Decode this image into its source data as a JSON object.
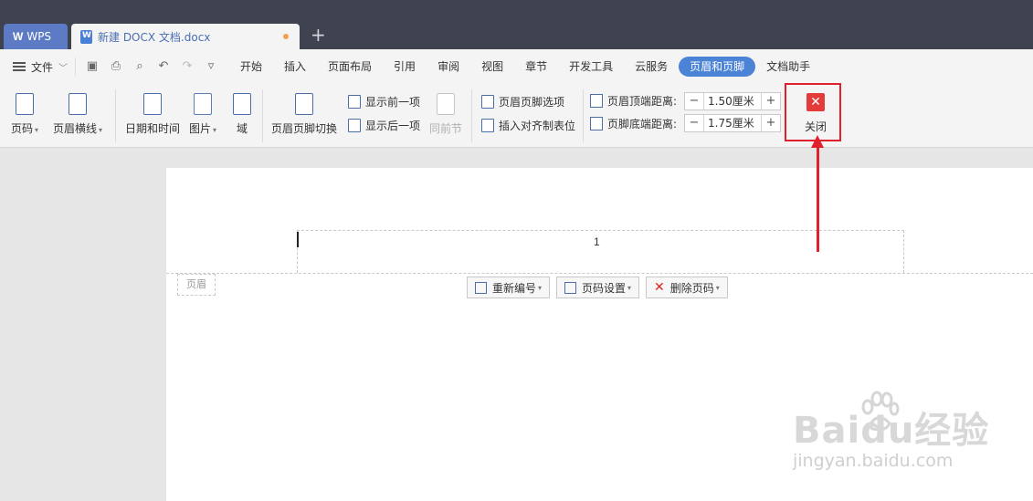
{
  "tabs": {
    "wps_label": "WPS",
    "doc_label": "新建 DOCX 文档.docx",
    "new_tab_symbol": "+"
  },
  "menu": {
    "file_label": "文件",
    "items": [
      "开始",
      "插入",
      "页面布局",
      "引用",
      "审阅",
      "视图",
      "章节",
      "开发工具",
      "云服务",
      "页眉和页脚",
      "文档助手"
    ],
    "active_index": 9
  },
  "ribbon": {
    "page_number": "页码",
    "header_line": "页眉横线",
    "date_time": "日期和时间",
    "picture": "图片",
    "field": "域",
    "switch_header_footer": "页眉页脚切换",
    "show_previous": "显示前一项",
    "show_next": "显示后一项",
    "same_as_previous": "同前节",
    "header_footer_options": "页眉页脚选项",
    "insert_align_tab": "插入对齐制表位",
    "header_top_distance_label": "页眉顶端距离:",
    "header_top_distance_value": "1.50厘米",
    "footer_bottom_distance_label": "页脚底端距离:",
    "footer_bottom_distance_value": "1.75厘米",
    "close_label": "关闭"
  },
  "document": {
    "page_number_text": "1",
    "header_tag": "页眉",
    "renumber_label": "重新编号",
    "page_number_settings_label": "页码设置",
    "delete_page_number_label": "删除页码"
  },
  "watermark": {
    "main": "Baidu经验",
    "sub": "jingyan.baidu.com"
  },
  "colors": {
    "titlebar": "#3f4350",
    "accent": "#4b83d6",
    "highlight": "#e0202a"
  }
}
